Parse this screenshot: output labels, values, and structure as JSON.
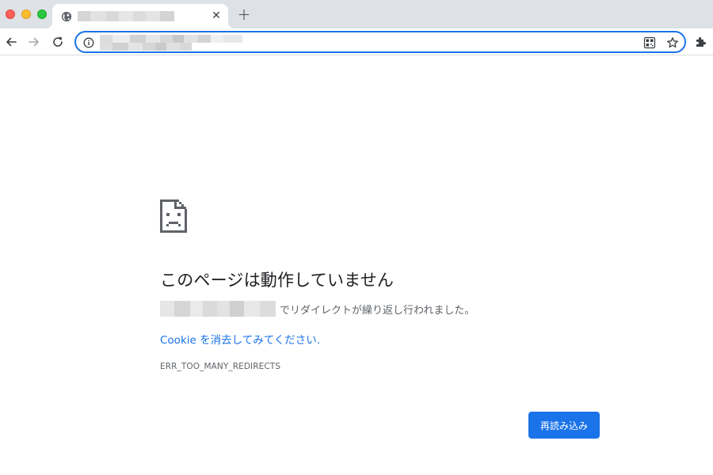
{
  "browser": {
    "tab": {
      "close_glyph": "✕",
      "favicon": "globe-icon"
    },
    "new_tab_glyph": "+",
    "toolbar": {
      "back_icon": "arrow-left-icon",
      "forward_icon": "arrow-right-icon",
      "reload_icon": "reload-icon",
      "site_info_icon": "info-icon",
      "qr_icon": "qr-code-icon",
      "bookmark_icon": "star-icon",
      "extensions_icon": "puzzle-icon"
    }
  },
  "error_page": {
    "icon": "sad-page-icon",
    "headline": "このページは動作していません",
    "redirect_detail": "でリダイレクトが繰り返し行われました。",
    "cookie_link": "Cookie を消去してみてください.",
    "error_code": "ERR_TOO_MANY_REDIRECTS",
    "reload_button": "再読み込み"
  },
  "colors": {
    "accent": "#1a73e8",
    "tabstrip": "#dee1e6",
    "headline_text": "#202124",
    "secondary_text": "#5f6368"
  }
}
